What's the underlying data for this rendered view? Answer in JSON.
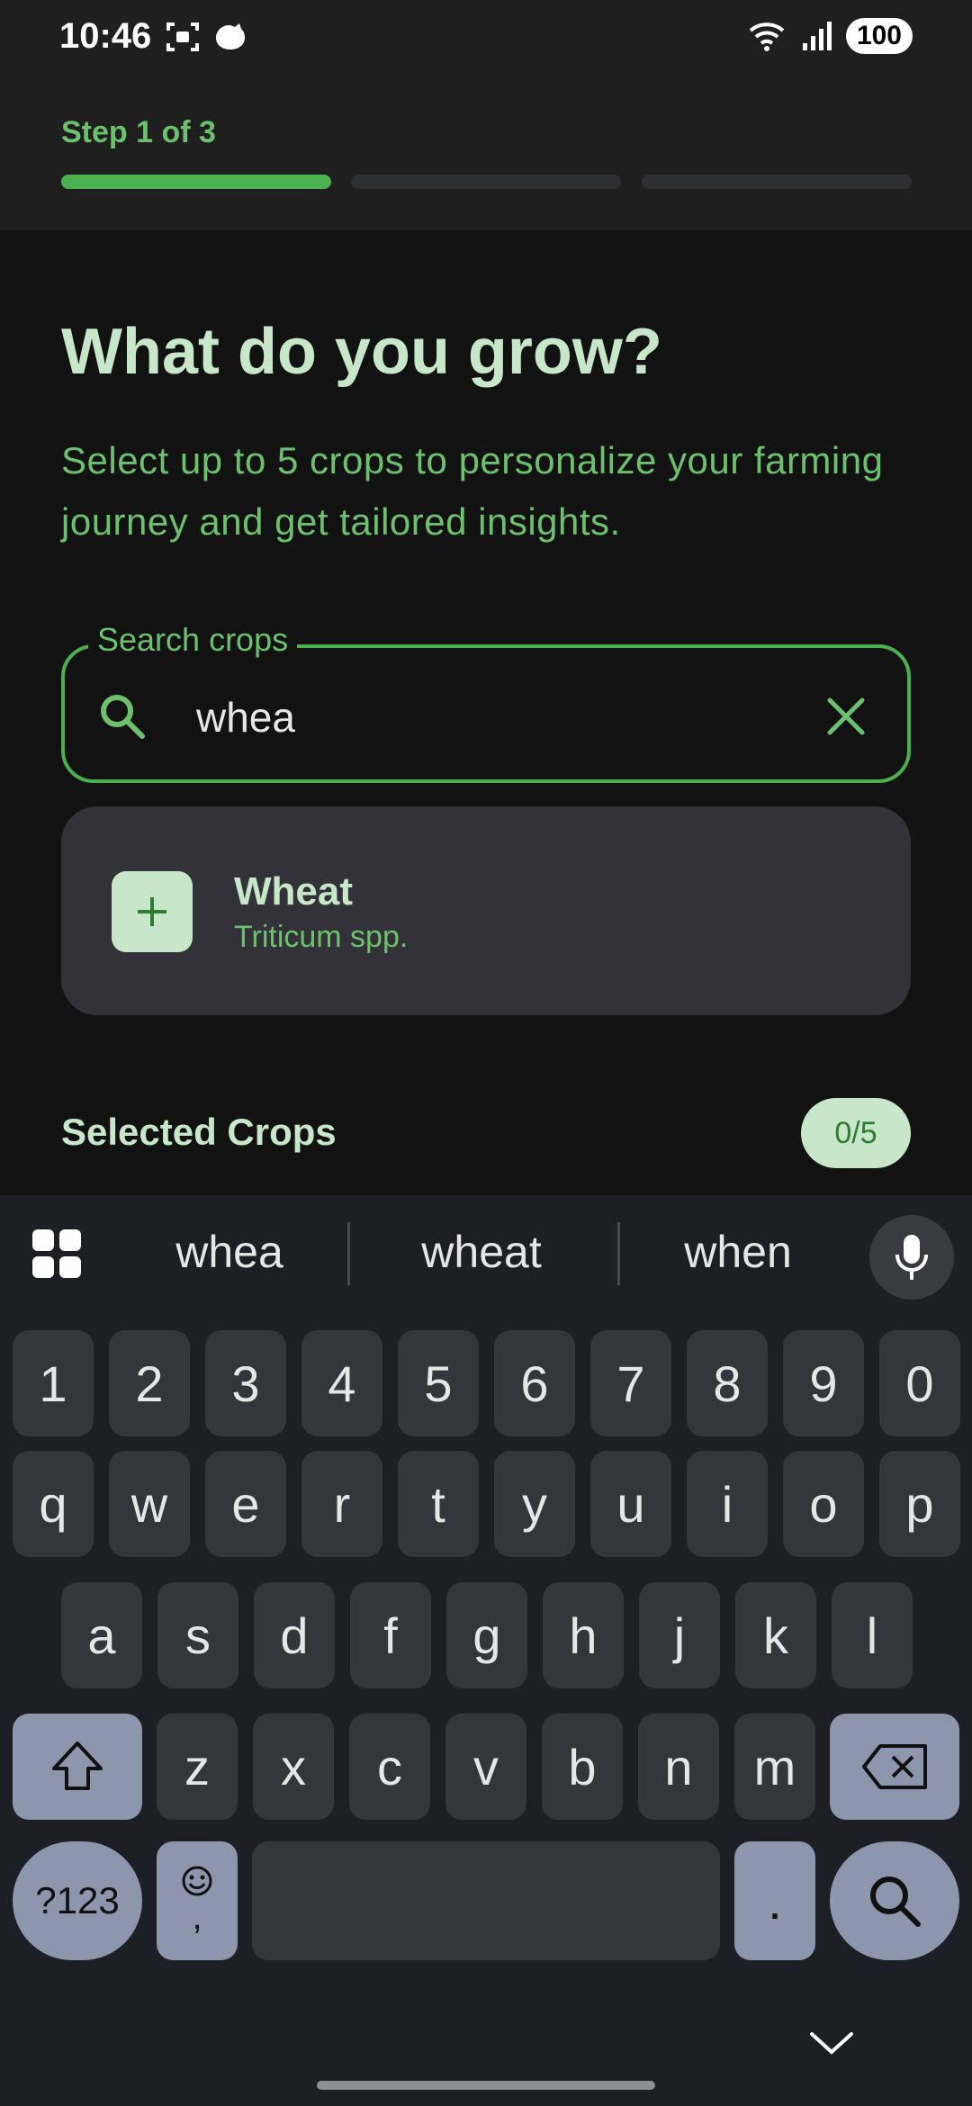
{
  "status_bar": {
    "time": "10:46",
    "battery": "100"
  },
  "onboarding": {
    "step_label": "Step 1 of 3",
    "progress_fraction": 0.3333,
    "title": "What do you grow?",
    "subtitle": "Select up to 5 crops to personalize your farming journey and get tailored insights."
  },
  "search": {
    "label": "Search crops",
    "value": "whea"
  },
  "results": [
    {
      "name": "Wheat",
      "scientific": "Triticum spp."
    }
  ],
  "selected": {
    "label": "Selected Crops",
    "count": "0/5"
  },
  "keyboard": {
    "suggestions": [
      "whea",
      "wheat",
      "when"
    ],
    "row_numbers": [
      "1",
      "2",
      "3",
      "4",
      "5",
      "6",
      "7",
      "8",
      "9",
      "0"
    ],
    "row1": [
      "q",
      "w",
      "e",
      "r",
      "t",
      "y",
      "u",
      "i",
      "o",
      "p"
    ],
    "row2": [
      "a",
      "s",
      "d",
      "f",
      "g",
      "h",
      "j",
      "k",
      "l"
    ],
    "row3": [
      "z",
      "x",
      "c",
      "v",
      "b",
      "n",
      "m"
    ],
    "symbols_key": "?123",
    "comma_key": ",",
    "period_key": "."
  },
  "colors": {
    "accent": "#4caf50",
    "accent_text": "#6cc06e",
    "pale_green": "#c8e6c9"
  }
}
